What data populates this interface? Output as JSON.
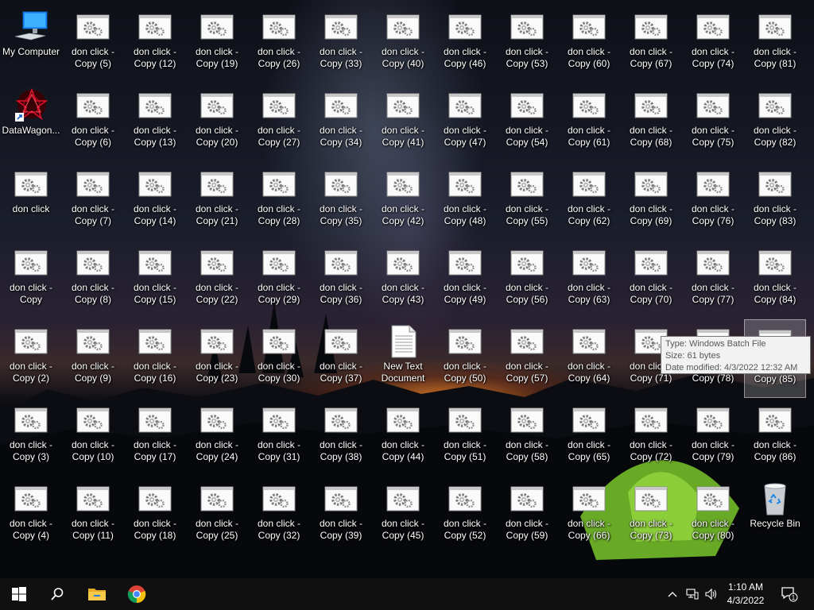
{
  "desktop": {
    "column_labels": [
      [
        {
          "l1": "My Computer",
          "l2": "",
          "type": "computer"
        },
        {
          "l1": "DataWagon...",
          "l2": "",
          "type": "datawagon"
        },
        {
          "l1": "don click",
          "l2": "",
          "type": "bat"
        },
        {
          "l1": "don click -",
          "l2": "Copy",
          "type": "bat"
        },
        {
          "l1": "don click -",
          "l2": "Copy (2)",
          "type": "bat"
        },
        {
          "l1": "don click -",
          "l2": "Copy (3)",
          "type": "bat"
        },
        {
          "l1": "don click -",
          "l2": "Copy (4)",
          "type": "bat"
        }
      ],
      [
        {
          "l1": "don click -",
          "l2": "Copy (5)",
          "type": "bat"
        },
        {
          "l1": "don click -",
          "l2": "Copy (6)",
          "type": "bat"
        },
        {
          "l1": "don click -",
          "l2": "Copy (7)",
          "type": "bat"
        },
        {
          "l1": "don click -",
          "l2": "Copy (8)",
          "type": "bat"
        },
        {
          "l1": "don click -",
          "l2": "Copy (9)",
          "type": "bat"
        },
        {
          "l1": "don click -",
          "l2": "Copy (10)",
          "type": "bat"
        },
        {
          "l1": "don click -",
          "l2": "Copy (11)",
          "type": "bat"
        }
      ],
      [
        {
          "l1": "don click -",
          "l2": "Copy (12)",
          "type": "bat"
        },
        {
          "l1": "don click -",
          "l2": "Copy (13)",
          "type": "bat"
        },
        {
          "l1": "don click -",
          "l2": "Copy (14)",
          "type": "bat"
        },
        {
          "l1": "don click -",
          "l2": "Copy (15)",
          "type": "bat"
        },
        {
          "l1": "don click -",
          "l2": "Copy (16)",
          "type": "bat"
        },
        {
          "l1": "don click -",
          "l2": "Copy (17)",
          "type": "bat"
        },
        {
          "l1": "don click -",
          "l2": "Copy (18)",
          "type": "bat"
        }
      ],
      [
        {
          "l1": "don click -",
          "l2": "Copy (19)",
          "type": "bat"
        },
        {
          "l1": "don click -",
          "l2": "Copy (20)",
          "type": "bat"
        },
        {
          "l1": "don click -",
          "l2": "Copy (21)",
          "type": "bat"
        },
        {
          "l1": "don click -",
          "l2": "Copy (22)",
          "type": "bat"
        },
        {
          "l1": "don click -",
          "l2": "Copy (23)",
          "type": "bat"
        },
        {
          "l1": "don click -",
          "l2": "Copy (24)",
          "type": "bat"
        },
        {
          "l1": "don click -",
          "l2": "Copy (25)",
          "type": "bat"
        }
      ],
      [
        {
          "l1": "don click -",
          "l2": "Copy (26)",
          "type": "bat"
        },
        {
          "l1": "don click -",
          "l2": "Copy (27)",
          "type": "bat"
        },
        {
          "l1": "don click -",
          "l2": "Copy (28)",
          "type": "bat"
        },
        {
          "l1": "don click -",
          "l2": "Copy (29)",
          "type": "bat"
        },
        {
          "l1": "don click -",
          "l2": "Copy (30)",
          "type": "bat"
        },
        {
          "l1": "don click -",
          "l2": "Copy (31)",
          "type": "bat"
        },
        {
          "l1": "don click -",
          "l2": "Copy (32)",
          "type": "bat"
        }
      ],
      [
        {
          "l1": "don click -",
          "l2": "Copy (33)",
          "type": "bat"
        },
        {
          "l1": "don click -",
          "l2": "Copy (34)",
          "type": "bat"
        },
        {
          "l1": "don click -",
          "l2": "Copy (35)",
          "type": "bat"
        },
        {
          "l1": "don click -",
          "l2": "Copy (36)",
          "type": "bat"
        },
        {
          "l1": "don click -",
          "l2": "Copy (37)",
          "type": "bat"
        },
        {
          "l1": "don click -",
          "l2": "Copy (38)",
          "type": "bat"
        },
        {
          "l1": "don click -",
          "l2": "Copy (39)",
          "type": "bat"
        }
      ],
      [
        {
          "l1": "don click -",
          "l2": "Copy (40)",
          "type": "bat"
        },
        {
          "l1": "don click -",
          "l2": "Copy (41)",
          "type": "bat"
        },
        {
          "l1": "don click -",
          "l2": "Copy (42)",
          "type": "bat"
        },
        {
          "l1": "don click -",
          "l2": "Copy (43)",
          "type": "bat"
        },
        {
          "l1": "New Text",
          "l2": "Document",
          "type": "text"
        },
        {
          "l1": "don click -",
          "l2": "Copy (44)",
          "type": "bat"
        },
        {
          "l1": "don click -",
          "l2": "Copy (45)",
          "type": "bat"
        }
      ],
      [
        {
          "l1": "don click -",
          "l2": "Copy (46)",
          "type": "bat"
        },
        {
          "l1": "don click -",
          "l2": "Copy (47)",
          "type": "bat"
        },
        {
          "l1": "don click -",
          "l2": "Copy (48)",
          "type": "bat"
        },
        {
          "l1": "don click -",
          "l2": "Copy (49)",
          "type": "bat"
        },
        {
          "l1": "don click -",
          "l2": "Copy (50)",
          "type": "bat"
        },
        {
          "l1": "don click -",
          "l2": "Copy (51)",
          "type": "bat"
        },
        {
          "l1": "don click -",
          "l2": "Copy (52)",
          "type": "bat"
        }
      ],
      [
        {
          "l1": "don click -",
          "l2": "Copy (53)",
          "type": "bat"
        },
        {
          "l1": "don click -",
          "l2": "Copy (54)",
          "type": "bat"
        },
        {
          "l1": "don click -",
          "l2": "Copy (55)",
          "type": "bat"
        },
        {
          "l1": "don click -",
          "l2": "Copy (56)",
          "type": "bat"
        },
        {
          "l1": "don click -",
          "l2": "Copy (57)",
          "type": "bat"
        },
        {
          "l1": "don click -",
          "l2": "Copy (58)",
          "type": "bat"
        },
        {
          "l1": "don click -",
          "l2": "Copy (59)",
          "type": "bat"
        }
      ],
      [
        {
          "l1": "don click -",
          "l2": "Copy (60)",
          "type": "bat"
        },
        {
          "l1": "don click -",
          "l2": "Copy (61)",
          "type": "bat"
        },
        {
          "l1": "don click -",
          "l2": "Copy (62)",
          "type": "bat"
        },
        {
          "l1": "don click -",
          "l2": "Copy (63)",
          "type": "bat"
        },
        {
          "l1": "don click -",
          "l2": "Copy (64)",
          "type": "bat"
        },
        {
          "l1": "don click -",
          "l2": "Copy (65)",
          "type": "bat"
        },
        {
          "l1": "don click -",
          "l2": "Copy (66)",
          "type": "bat"
        }
      ],
      [
        {
          "l1": "don click -",
          "l2": "Copy (67)",
          "type": "bat"
        },
        {
          "l1": "don click -",
          "l2": "Copy (68)",
          "type": "bat"
        },
        {
          "l1": "don click -",
          "l2": "Copy (69)",
          "type": "bat"
        },
        {
          "l1": "don click -",
          "l2": "Copy (70)",
          "type": "bat"
        },
        {
          "l1": "don click -",
          "l2": "Copy (71)",
          "type": "bat"
        },
        {
          "l1": "don click -",
          "l2": "Copy (72)",
          "type": "bat"
        },
        {
          "l1": "don click -",
          "l2": "Copy (73)",
          "type": "bat"
        }
      ],
      [
        {
          "l1": "don click -",
          "l2": "Copy (74)",
          "type": "bat"
        },
        {
          "l1": "don click -",
          "l2": "Copy (75)",
          "type": "bat"
        },
        {
          "l1": "don click -",
          "l2": "Copy (76)",
          "type": "bat"
        },
        {
          "l1": "don click -",
          "l2": "Copy (77)",
          "type": "bat"
        },
        {
          "l1": "don click -",
          "l2": "Copy (78)",
          "type": "bat"
        },
        {
          "l1": "don click -",
          "l2": "Copy (79)",
          "type": "bat"
        },
        {
          "l1": "don click -",
          "l2": "Copy (80)",
          "type": "bat"
        }
      ],
      [
        {
          "l1": "don click -",
          "l2": "Copy (81)",
          "type": "bat"
        },
        {
          "l1": "don click -",
          "l2": "Copy (82)",
          "type": "bat"
        },
        {
          "l1": "don click -",
          "l2": "Copy (83)",
          "type": "bat"
        },
        {
          "l1": "don click -",
          "l2": "Copy (84)",
          "type": "bat"
        },
        {
          "l1": "don click -",
          "l2": "Copy (85)",
          "type": "bat",
          "selected": true
        },
        {
          "l1": "don click -",
          "l2": "Copy (86)",
          "type": "bat"
        },
        {
          "l1": "Recycle Bin",
          "l2": "",
          "type": "recycle"
        }
      ]
    ]
  },
  "tooltip": {
    "type_line": "Type: Windows Batch File",
    "size_line": "Size: 61 bytes",
    "date_line": "Date modified: 4/3/2022 12:32 AM"
  },
  "taskbar": {
    "icons": [
      "windows-start-icon",
      "search-icon",
      "file-explorer-icon",
      "chrome-icon"
    ],
    "tray_icons": [
      "chevron-up-icon",
      "network-icon",
      "volume-icon"
    ],
    "time": "1:10 AM",
    "date": "4/3/2022",
    "notification_count": "1"
  }
}
